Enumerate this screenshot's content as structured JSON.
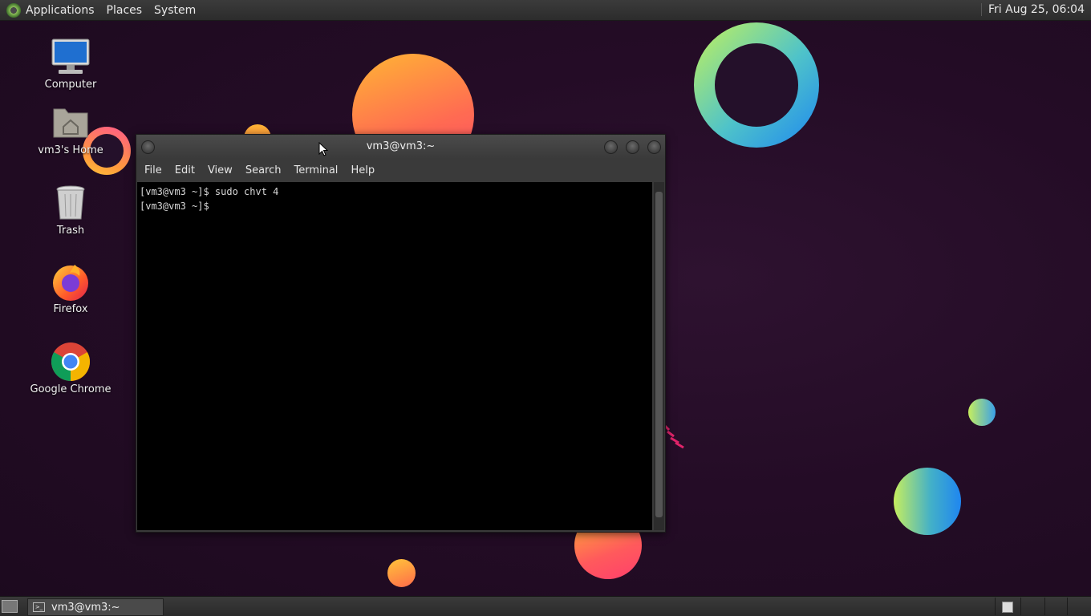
{
  "top_panel": {
    "menus": [
      "Applications",
      "Places",
      "System"
    ],
    "clock": "Fri Aug 25, 06:04"
  },
  "desktop_icons": [
    {
      "label": "Computer",
      "icon": "computer-icon"
    },
    {
      "label": "vm3's Home",
      "icon": "home-folder-icon"
    },
    {
      "label": "Trash",
      "icon": "trash-icon"
    },
    {
      "label": "Firefox",
      "icon": "firefox-icon"
    },
    {
      "label": "Google Chrome",
      "icon": "chrome-icon"
    }
  ],
  "terminal": {
    "title": "vm3@vm3:~",
    "menu": [
      "File",
      "Edit",
      "View",
      "Search",
      "Terminal",
      "Help"
    ],
    "lines": [
      "[vm3@vm3 ~]$ sudo chvt 4",
      "[vm3@vm3 ~]$ "
    ]
  },
  "taskbar": {
    "tasks": [
      {
        "label": "vm3@vm3:~",
        "icon": "terminal-icon"
      }
    ]
  },
  "colors": {
    "panel": "#2f2f2f",
    "desktop_bg": "#240c26",
    "terminal_bg": "#000000"
  }
}
